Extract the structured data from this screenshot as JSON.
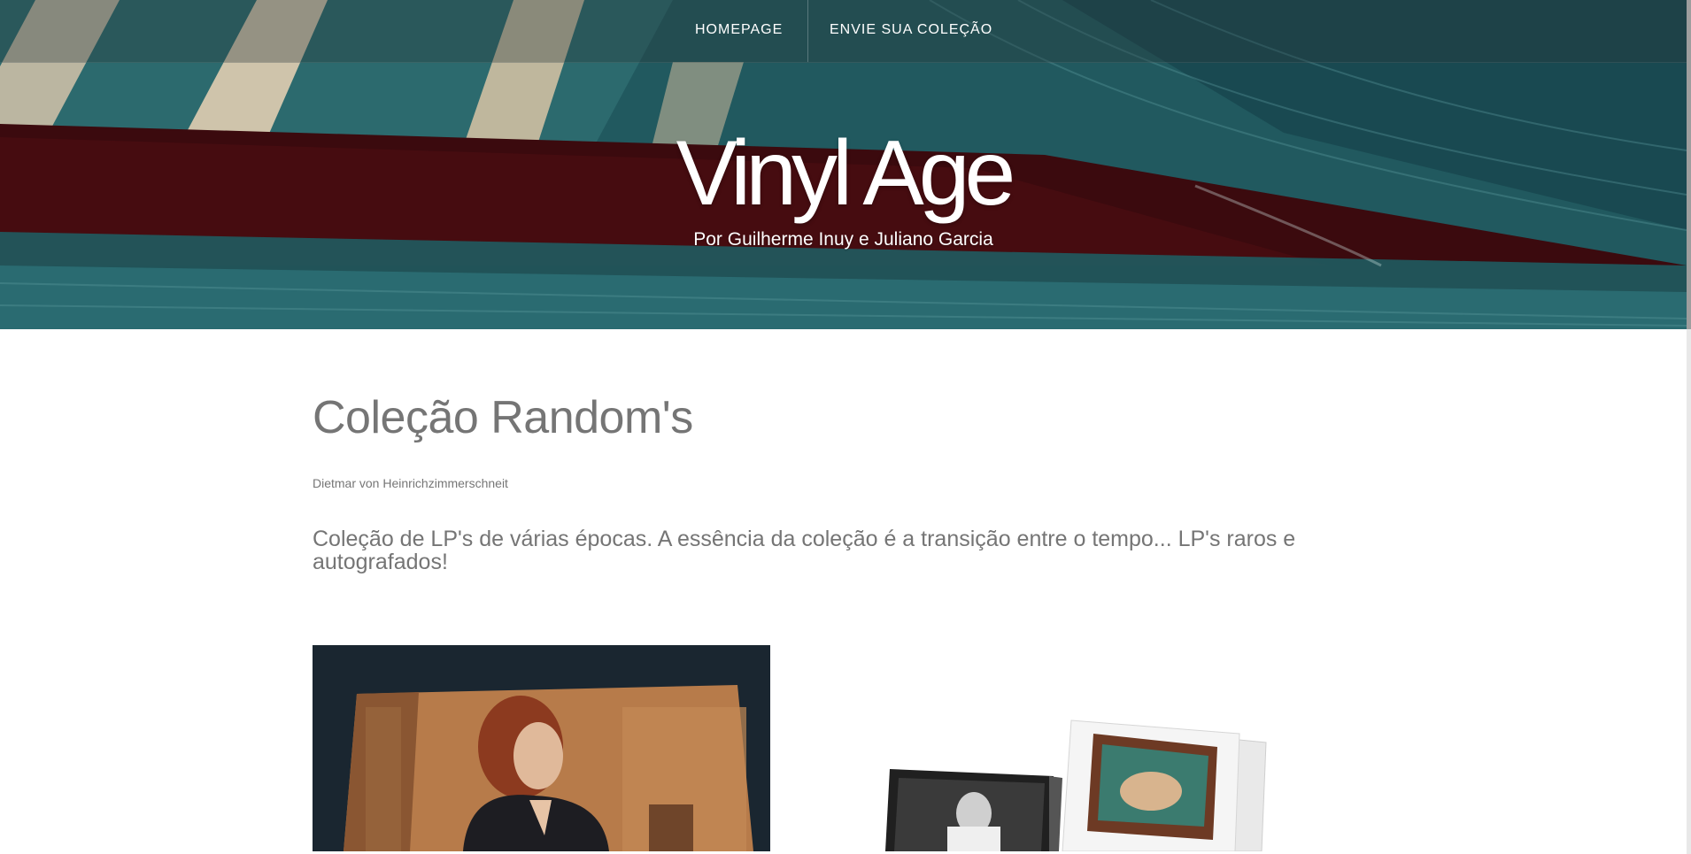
{
  "nav": {
    "items": [
      {
        "label": "HOMEPAGE"
      },
      {
        "label": "ENVIE SUA COLEÇÃO"
      }
    ]
  },
  "hero": {
    "title": "Vinyl Age",
    "subtitle": "Por Guilherme Inuy e Juliano Garcia"
  },
  "collection": {
    "title": "Coleção Random's",
    "author": "Dietmar von Heinrichzimmerschneit",
    "description": "Coleção de LP's de várias épocas. A essência da coleção é a transição entre o tempo... LP's raros e autografados!"
  },
  "colors": {
    "hero_teal": "#23666c",
    "hero_maroon": "#3b0a0e",
    "text_gray": "#757575",
    "accent_green": "#3aa04a"
  }
}
